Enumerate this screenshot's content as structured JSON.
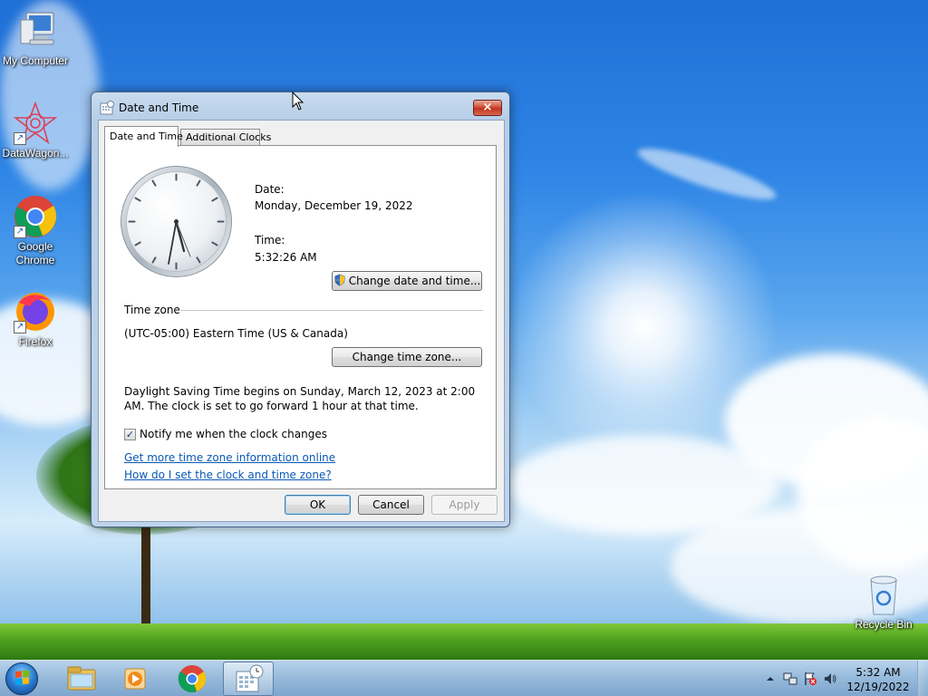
{
  "desktop": {
    "icons": [
      {
        "label": "My Computer",
        "icon": "computer-icon"
      },
      {
        "label": "DataWagon...",
        "icon": "datawagon-icon"
      },
      {
        "label": "Google Chrome",
        "icon": "chrome-icon"
      },
      {
        "label": "Firefox",
        "icon": "firefox-icon"
      },
      {
        "label": "Recycle Bin",
        "icon": "recycle-bin-icon"
      }
    ]
  },
  "dialog": {
    "title": "Date and Time",
    "close_label": "×",
    "tabs": [
      {
        "label": "Date and Time",
        "selected": true
      },
      {
        "label": "Additional Clocks",
        "selected": false
      }
    ],
    "date_label": "Date:",
    "date_value": "Monday, December 19, 2022",
    "time_label": "Time:",
    "time_value": "5:32:26 AM",
    "change_datetime_button": "Change date and time...",
    "timezone_heading": "Time zone",
    "timezone_value": "(UTC-05:00) Eastern Time (US & Canada)",
    "change_timezone_button": "Change time zone...",
    "dst_text": "Daylight Saving Time begins on Sunday, March 12, 2023 at 2:00 AM. The clock is set to go forward 1 hour at that time.",
    "notify_checkbox_label": "Notify me when the clock changes",
    "notify_checked": true,
    "link_more_info": "Get more time zone information online",
    "link_how_to": "How do I set the clock and time zone?",
    "ok_button": "OK",
    "cancel_button": "Cancel",
    "apply_button": "Apply",
    "apply_enabled": false
  },
  "taskbar": {
    "pinned": [
      {
        "icon": "windows-explorer-icon"
      },
      {
        "icon": "media-player-icon"
      },
      {
        "icon": "chrome-icon"
      },
      {
        "icon": "date-time-control-panel-icon",
        "active": true
      }
    ],
    "clock_time": "5:32 AM",
    "clock_date": "12/19/2022"
  },
  "colors": {
    "link": "#0a59b5",
    "close_button": "#c1331e",
    "dialog_frame": "#b7cee8"
  }
}
